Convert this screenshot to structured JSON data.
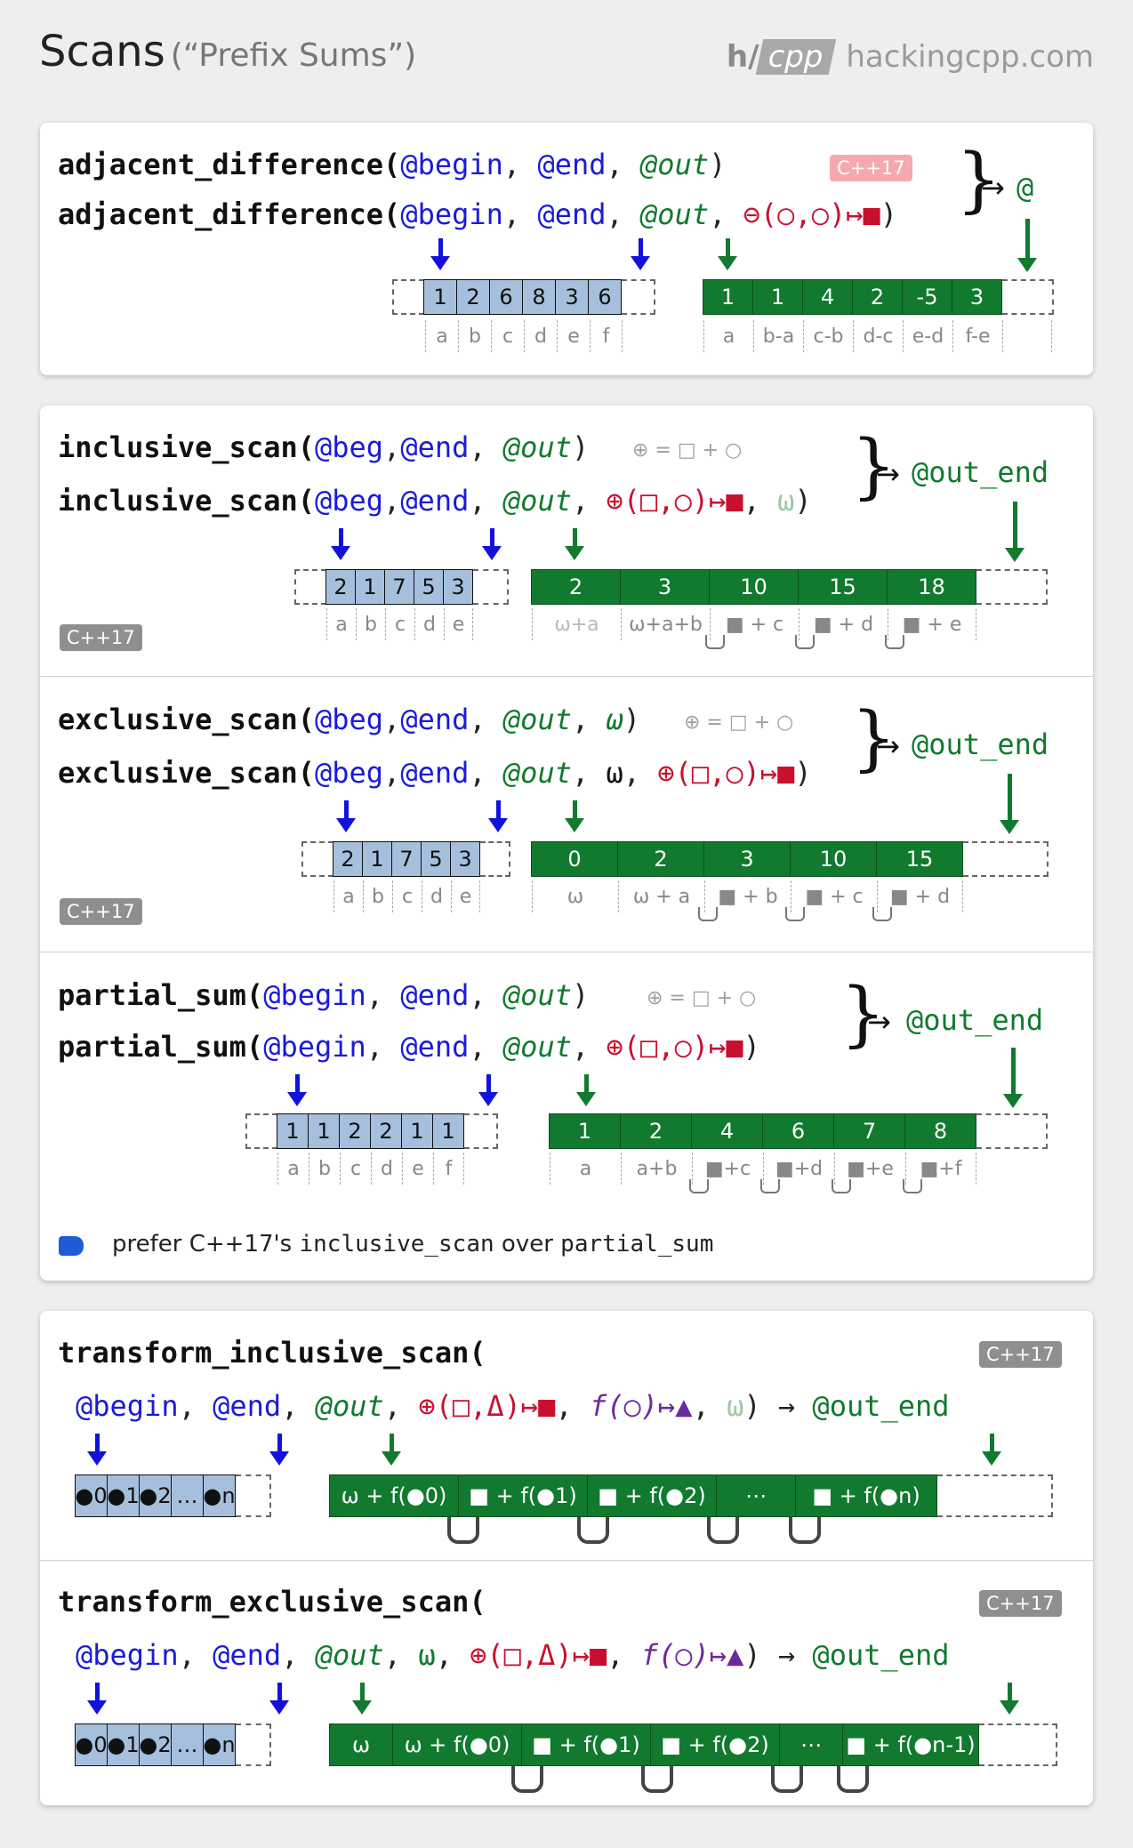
{
  "header": {
    "title": "Scans",
    "subtitle": "(“Prefix Sums”)",
    "logo_h": "h/",
    "logo_cpp": "cpp",
    "site": "hackingcpp.com"
  },
  "adjacent": {
    "line1": {
      "name": "adjacent_difference(",
      "begin": "@begin",
      "end": "@end",
      "out": "@out",
      "close": ")"
    },
    "line2": {
      "name": "adjacent_difference(",
      "begin": "@begin",
      "end": "@end",
      "out": "@out",
      "op": "⊖(○,○)↦■",
      "close": ")"
    },
    "badge": "C++17",
    "returns": "@",
    "input": [
      "1",
      "2",
      "6",
      "8",
      "3",
      "6"
    ],
    "input_labels": [
      "a",
      "b",
      "c",
      "d",
      "e",
      "f"
    ],
    "output": [
      "1",
      "1",
      "4",
      "2",
      "-5",
      "3"
    ],
    "output_labels": [
      "a",
      "b-a",
      "c-b",
      "d-c",
      "e-d",
      "f-e"
    ]
  },
  "inclusive": {
    "line1": {
      "name": "inclusive_scan(",
      "beg": "@beg",
      "end": "@end",
      "out": "@out",
      "close": ")",
      "hint": "⊕ = □ + ○"
    },
    "line2": {
      "name": "inclusive_scan(",
      "beg": "@beg",
      "end": "@end",
      "out": "@out",
      "op": "⊕(□,○)↦■",
      "init": "ω",
      "close": ")"
    },
    "badge": "C++17",
    "returns": "@out_end",
    "input": [
      "2",
      "1",
      "7",
      "5",
      "3"
    ],
    "input_labels": [
      "a",
      "b",
      "c",
      "d",
      "e"
    ],
    "output": [
      "2",
      "3",
      "10",
      "15",
      "18"
    ],
    "output_labels": [
      "ω+a",
      "ω+a+b",
      "■ + c",
      "■ + d",
      "■ + e"
    ]
  },
  "exclusive": {
    "line1": {
      "name": "exclusive_scan(",
      "beg": "@beg",
      "end": "@end",
      "out": "@out",
      "init": "ω",
      "close": ")",
      "hint": "⊕ = □ + ○"
    },
    "line2": {
      "name": "exclusive_scan(",
      "beg": "@beg",
      "end": "@end",
      "out": "@out",
      "init": "ω",
      "op": "⊕(□,○)↦■",
      "close": ")"
    },
    "badge": "C++17",
    "returns": "@out_end",
    "input": [
      "2",
      "1",
      "7",
      "5",
      "3"
    ],
    "input_labels": [
      "a",
      "b",
      "c",
      "d",
      "e"
    ],
    "output": [
      "0",
      "2",
      "3",
      "10",
      "15"
    ],
    "output_labels": [
      "ω",
      "ω + a",
      "■ + b",
      "■ + c",
      "■ + d"
    ]
  },
  "partial": {
    "line1": {
      "name": "partial_sum(",
      "begin": "@begin",
      "end": "@end",
      "out": "@out",
      "close": ")",
      "hint": "⊕ = □ + ○"
    },
    "line2": {
      "name": "partial_sum(",
      "begin": "@begin",
      "end": "@end",
      "out": "@out",
      "op": "⊕(□,○)↦■",
      "close": ")"
    },
    "returns": "@out_end",
    "input": [
      "1",
      "1",
      "2",
      "2",
      "1",
      "1"
    ],
    "input_labels": [
      "a",
      "b",
      "c",
      "d",
      "e",
      "f"
    ],
    "output": [
      "1",
      "2",
      "4",
      "6",
      "7",
      "8"
    ],
    "output_labels": [
      "a",
      "a+b",
      "■+c",
      "■+d",
      "■+e",
      "■+f"
    ],
    "note": {
      "pre": "prefer C++17's ",
      "code1": "inclusive_scan",
      "mid": " over ",
      "code2": "partial_sum"
    }
  },
  "t_inclusive": {
    "name": "transform_inclusive_scan(",
    "begin": "@begin",
    "end": "@end",
    "out": "@out",
    "op": "⊕(□,Δ)↦■",
    "f": "f(○)↦▲",
    "init": "ω",
    "close": ")",
    "returns": "@out_end",
    "badge": "C++17",
    "input": [
      "●0",
      "●1",
      "●2",
      "…",
      "●n"
    ],
    "output": [
      "ω + f(●0)",
      "■ + f(●1)",
      "■ + f(●2)",
      "⋯",
      "■ + f(●n)"
    ]
  },
  "t_exclusive": {
    "name": "transform_exclusive_scan(",
    "begin": "@begin",
    "end": "@end",
    "out": "@out",
    "init": "ω",
    "op": "⊕(□,Δ)↦■",
    "f": "f(○)↦▲",
    "close": ")",
    "returns": "@out_end",
    "badge": "C++17",
    "input": [
      "●0",
      "●1",
      "●2",
      "…",
      "●n"
    ],
    "output": [
      "ω",
      "ω + f(●0)",
      "■ + f(●1)",
      "■ + f(●2)",
      "⋯",
      "■ + f(●n-1)"
    ]
  },
  "colors": {
    "input": "#a6bfdc",
    "output": "#117a2e",
    "iterator": "#1212dc",
    "out_iterator": "#117a2e",
    "operator": "#c8102e",
    "function": "#6b2a9e"
  }
}
